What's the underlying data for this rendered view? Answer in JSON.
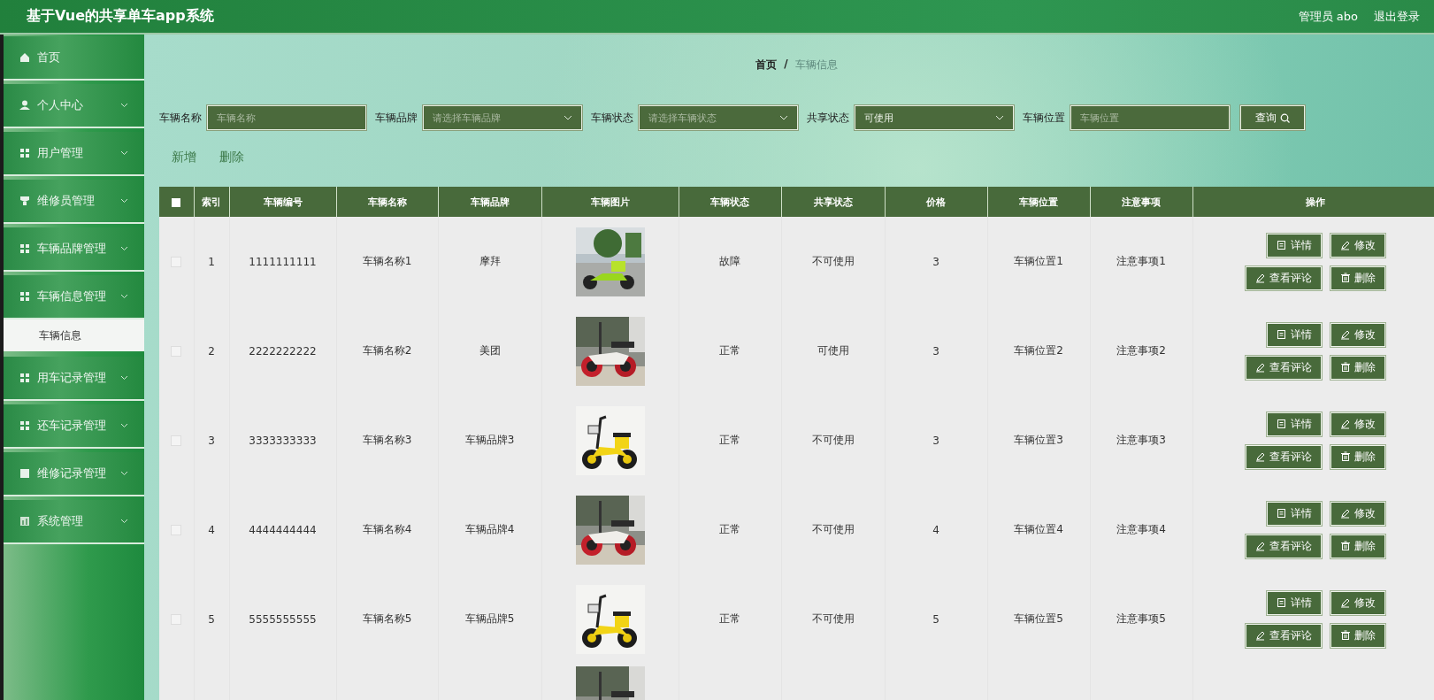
{
  "header": {
    "title": "基于Vue的共享单车app系统",
    "user": "管理员 abo",
    "logout": "退出登录"
  },
  "sidebar": {
    "items": [
      {
        "kind": "home",
        "label": "首页"
      },
      {
        "kind": "user",
        "label": "个人中心"
      },
      {
        "kind": "grid",
        "label": "用户管理"
      },
      {
        "kind": "badge",
        "label": "维修员管理"
      },
      {
        "kind": "grid",
        "label": "车辆品牌管理"
      },
      {
        "kind": "grid",
        "label": "车辆信息管理",
        "children": [
          {
            "label": "车辆信息",
            "selected": true
          }
        ]
      },
      {
        "kind": "grid",
        "label": "用车记录管理"
      },
      {
        "kind": "grid",
        "label": "还车记录管理"
      },
      {
        "kind": "square",
        "label": "维修记录管理"
      },
      {
        "kind": "chart",
        "label": "系统管理"
      }
    ]
  },
  "breadcrumb": [
    {
      "label": "首页",
      "current": false
    },
    {
      "label": "车辆信息",
      "current": true
    }
  ],
  "breadcrumb_separator": "/",
  "filters": [
    {
      "kind": "input",
      "label": "车辆名称",
      "placeholder": "车辆名称"
    },
    {
      "kind": "select",
      "label": "车辆品牌",
      "placeholder": "请选择车辆品牌"
    },
    {
      "kind": "select",
      "label": "车辆状态",
      "placeholder": "请选择车辆状态"
    },
    {
      "kind": "select",
      "label": "共享状态",
      "value": "可使用"
    },
    {
      "kind": "input",
      "label": "车辆位置",
      "placeholder": "车辆位置"
    }
  ],
  "search_button": "查询",
  "actions": [
    "新增",
    "删除"
  ],
  "table": {
    "select_all": {
      "checked": false
    },
    "columns": [
      "索引",
      "车辆编号",
      "车辆名称",
      "车辆品牌",
      "车辆图片",
      "车辆状态",
      "共享状态",
      "价格",
      "车辆位置",
      "注意事项",
      "操作"
    ],
    "rows": [
      {
        "checked": false,
        "cells": [
          "1",
          "1111111111",
          "车辆名称1",
          "摩拜"
        ],
        "picture": {
          "kind": "picture"
        },
        "cells2": [
          "故障",
          "不可使用",
          "3",
          "车辆位置1",
          "注意事项1"
        ],
        "buttons": [
          {
            "kind": "detail",
            "label": "详情"
          },
          {
            "kind": "edit",
            "label": "修改"
          },
          {
            "kind": "edit",
            "label": "查看评论"
          },
          {
            "kind": "delete",
            "label": "删除"
          }
        ]
      },
      {
        "checked": false,
        "cells": [
          "2",
          "2222222222",
          "车辆名称2",
          "美团"
        ],
        "picture": {
          "kind": "picture"
        },
        "cells2": [
          "正常",
          "可使用",
          "3",
          "车辆位置2",
          "注意事项2"
        ],
        "buttons": [
          {
            "kind": "detail",
            "label": "详情"
          },
          {
            "kind": "edit",
            "label": "修改"
          },
          {
            "kind": "edit",
            "label": "查看评论"
          },
          {
            "kind": "delete",
            "label": "删除"
          }
        ]
      },
      {
        "checked": false,
        "cells": [
          "3",
          "3333333333",
          "车辆名称3",
          "车辆品牌3"
        ],
        "picture": {
          "kind": "picture"
        },
        "cells2": [
          "正常",
          "不可使用",
          "3",
          "车辆位置3",
          "注意事项3"
        ],
        "buttons": [
          {
            "kind": "detail",
            "label": "详情"
          },
          {
            "kind": "edit",
            "label": "修改"
          },
          {
            "kind": "edit",
            "label": "查看评论"
          },
          {
            "kind": "delete",
            "label": "删除"
          }
        ]
      },
      {
        "checked": false,
        "cells": [
          "4",
          "4444444444",
          "车辆名称4",
          "车辆品牌4"
        ],
        "picture": {
          "kind": "picture"
        },
        "cells2": [
          "正常",
          "不可使用",
          "4",
          "车辆位置4",
          "注意事项4"
        ],
        "buttons": [
          {
            "kind": "detail",
            "label": "详情"
          },
          {
            "kind": "edit",
            "label": "修改"
          },
          {
            "kind": "edit",
            "label": "查看评论"
          },
          {
            "kind": "delete",
            "label": "删除"
          }
        ]
      },
      {
        "checked": false,
        "cells": [
          "5",
          "5555555555",
          "车辆名称5",
          "车辆品牌5"
        ],
        "picture": {
          "kind": "picture"
        },
        "cells2": [
          "正常",
          "不可使用",
          "5",
          "车辆位置5",
          "注意事项5"
        ],
        "buttons": [
          {
            "kind": "detail",
            "label": "详情"
          },
          {
            "kind": "edit",
            "label": "修改"
          },
          {
            "kind": "edit",
            "label": "查看评论"
          },
          {
            "kind": "delete",
            "label": "删除"
          }
        ]
      },
      {
        "picture": {
          "kind": "picture"
        }
      }
    ]
  }
}
